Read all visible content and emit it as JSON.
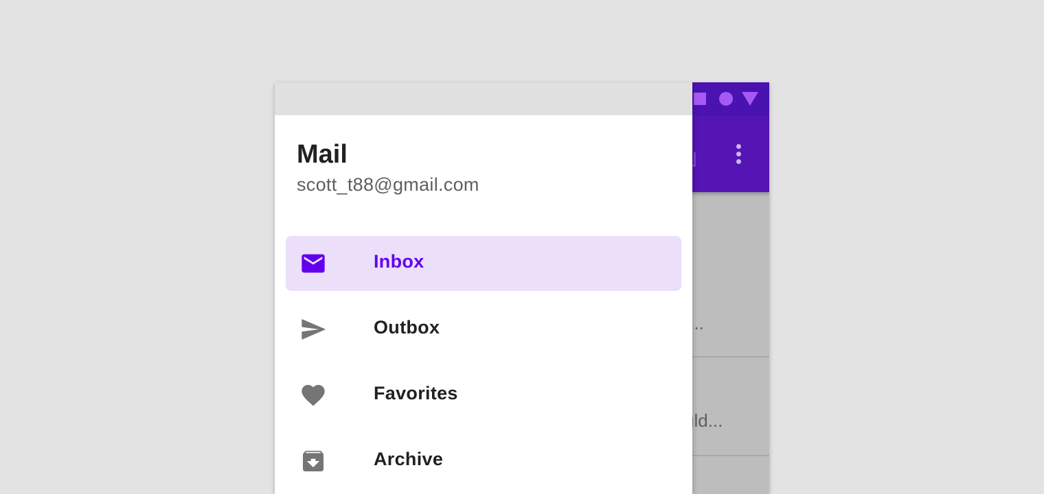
{
  "drawer": {
    "title": "Mail",
    "subtitle": "scott_t88@gmail.com",
    "items": [
      {
        "label": "Inbox",
        "icon": "mail-icon",
        "active": true
      },
      {
        "label": "Outbox",
        "icon": "send-icon",
        "active": false
      },
      {
        "label": "Favorites",
        "icon": "heart-icon",
        "active": false
      },
      {
        "label": "Archive",
        "icon": "archive-icon",
        "active": false
      }
    ]
  },
  "background_app": {
    "list_snippets": [
      "r...",
      "uld..."
    ],
    "status_icons": [
      "square-icon",
      "circle-icon",
      "triangle-icon"
    ],
    "appbar_action": "more-vert-icon"
  },
  "colors": {
    "primary": "#6200ee",
    "app_bar": "#5514b4",
    "status_bar": "#4a12b0",
    "active_item_bg": "#ecdff9",
    "icon_grey": "#757575",
    "scrim": "#bdbdbd"
  }
}
